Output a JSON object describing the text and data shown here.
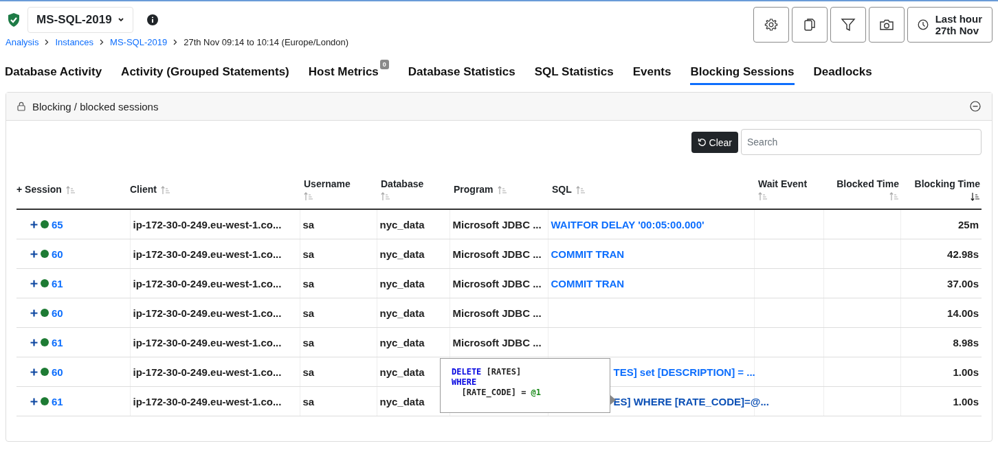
{
  "instance": {
    "name": "MS-SQL-2019",
    "healthy": true
  },
  "breadcrumbs": [
    {
      "label": "Analysis",
      "link": true
    },
    {
      "label": "Instances",
      "link": true
    },
    {
      "label": "MS-SQL-2019",
      "link": true
    },
    {
      "label": "27th Nov 09:14 to 10:14 (Europe/London)",
      "link": false
    }
  ],
  "toolbar": {
    "time_range": [
      "Last hour",
      "27th Nov"
    ]
  },
  "tabs": [
    {
      "label": "Database Activity",
      "selected": false
    },
    {
      "label": "Activity (Grouped Statements)",
      "selected": false
    },
    {
      "label": "Host Metrics",
      "selected": false,
      "badge": "0"
    },
    {
      "label": "Database Statistics",
      "selected": false
    },
    {
      "label": "SQL Statistics",
      "selected": false
    },
    {
      "label": "Events",
      "selected": false
    },
    {
      "label": "Blocking Sessions",
      "selected": true
    },
    {
      "label": "Deadlocks",
      "selected": false
    }
  ],
  "panel": {
    "title": "Blocking / blocked sessions",
    "clear_button": "Clear",
    "search": {
      "placeholder": "Search"
    }
  },
  "table": {
    "columns": [
      {
        "label": "+ Session",
        "sorted": false
      },
      {
        "label": "Client",
        "sorted": false
      },
      {
        "label": "Username",
        "sorted": false
      },
      {
        "label": "Database",
        "sorted": false
      },
      {
        "label": "Program",
        "sorted": false
      },
      {
        "label": "SQL",
        "sorted": false
      },
      {
        "label": "Wait Event",
        "sorted": false
      },
      {
        "label": "Blocked Time",
        "sorted": false
      },
      {
        "label": "Blocking Time",
        "sorted": true
      }
    ],
    "rows": [
      {
        "session": "65",
        "color": "#1e7b34",
        "client": "ip-172-30-0-249.eu-west-1.co...",
        "username": "sa",
        "database": "nyc_data",
        "program": "Microsoft JDBC ...",
        "sql": "WAITFOR DELAY '00:05:00.000'",
        "blocking_time": "25m"
      },
      {
        "session": "60",
        "color": "#1e7b34",
        "client": "ip-172-30-0-249.eu-west-1.co...",
        "username": "sa",
        "database": "nyc_data",
        "program": "Microsoft JDBC ...",
        "sql": "COMMIT TRAN",
        "blocking_time": "42.98s"
      },
      {
        "session": "61",
        "color": "#1e7b34",
        "client": "ip-172-30-0-249.eu-west-1.co...",
        "username": "sa",
        "database": "nyc_data",
        "program": "Microsoft JDBC ...",
        "sql": "COMMIT TRAN",
        "blocking_time": "37.00s"
      },
      {
        "session": "60",
        "color": "#1e7b34",
        "client": "ip-172-30-0-249.eu-west-1.co...",
        "username": "sa",
        "database": "nyc_data",
        "program": "Microsoft JDBC ...",
        "blocking_time": "14.00s"
      },
      {
        "session": "61",
        "color": "#1e7b34",
        "client": "ip-172-30-0-249.eu-west-1.co...",
        "username": "sa",
        "database": "nyc_data",
        "program": "Microsoft JDBC ...",
        "blocking_time": "8.98s"
      },
      {
        "session": "60",
        "color": "#1e7b34",
        "client": "ip-172-30-0-249.eu-west-1.co...",
        "username": "sa",
        "database": "nyc_data",
        "sql": "TES] set [DESCRIPTION] = ...",
        "sql_covered": true,
        "hovered": false,
        "blocking_time": "1.00s"
      },
      {
        "session": "61",
        "color": "#1e7b34",
        "client": "ip-172-30-0-249.eu-west-1.co...",
        "username": "sa",
        "database": "nyc_data",
        "sql": "ES] WHERE [RATE_CODE]=@...",
        "sql_covered": true,
        "hovered": true,
        "blocking_time": "1.00s"
      }
    ]
  },
  "tooltip": {
    "lines": [
      [
        {
          "text": "DELETE",
          "kind": "keyword"
        },
        {
          "text": " [RATES]",
          "kind": "plain"
        }
      ],
      [
        {
          "text": "WHERE",
          "kind": "keyword"
        }
      ],
      [
        {
          "text": "  [RATE_CODE] = ",
          "kind": "plain"
        },
        {
          "text": "@1",
          "kind": "param"
        }
      ]
    ]
  }
}
